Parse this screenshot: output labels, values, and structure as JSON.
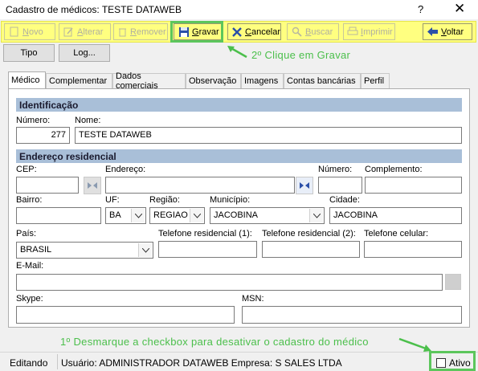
{
  "window": {
    "title": "Cadastro de médicos: TESTE DATAWEB",
    "help": "?",
    "close": "✕"
  },
  "toolbar": {
    "novo": "Novo",
    "alterar": "Alterar",
    "remover": "Remover",
    "gravar": "Gravar",
    "cancelar": "Cancelar",
    "buscar": "Buscar",
    "imprimir": "Imprimir",
    "voltar": "Voltar"
  },
  "actions": {
    "tipo": "Tipo",
    "log": "Log..."
  },
  "callouts": {
    "step2": "2º Clique em Gravar",
    "step1": "1º Desmarque a checkbox para desativar o cadastro do médico"
  },
  "tabs": [
    "Médico",
    "Complementar",
    "Dados comerciais",
    "Observação",
    "Imagens",
    "Contas bancárias",
    "Perfil"
  ],
  "identificacao": {
    "header": "Identificação",
    "numero_label": "Número:",
    "numero": "277",
    "nome_label": "Nome:",
    "nome": "TESTE DATAWEB"
  },
  "endereco": {
    "header": "Endereço residencial",
    "cep_label": "CEP:",
    "cep": "",
    "endereco_label": "Endereço:",
    "endereco": "",
    "numero_label": "Número:",
    "numero": "",
    "complemento_label": "Complemento:",
    "complemento": "",
    "bairro_label": "Bairro:",
    "bairro": "",
    "uf_label": "UF:",
    "uf": "BA",
    "regiao_label": "Região:",
    "regiao": "REGIAO",
    "municipio_label": "Município:",
    "municipio": "JACOBINA",
    "cidade_label": "Cidade:",
    "cidade": "JACOBINA",
    "pais_label": "País:",
    "pais": "BRASIL",
    "tel_res1_label": "Telefone residencial (1):",
    "tel_res1": "",
    "tel_res2_label": "Telefone residencial (2):",
    "tel_res2": "",
    "tel_cel_label": "Telefone celular:",
    "tel_cel": "",
    "email_label": "E-Mail:",
    "email": "",
    "skype_label": "Skype:",
    "skype": "",
    "msn_label": "MSN:",
    "msn": ""
  },
  "status": {
    "mode": "Editando",
    "info": "Usuário: ADMINISTRADOR DATAWEB Empresa: S SALES LTDA",
    "ativo_label": "Ativo",
    "ativo_checked": false
  },
  "colors": {
    "toolbar": "#ffff80",
    "highlight": "#5cc65c",
    "section": "#a9bfd8"
  }
}
